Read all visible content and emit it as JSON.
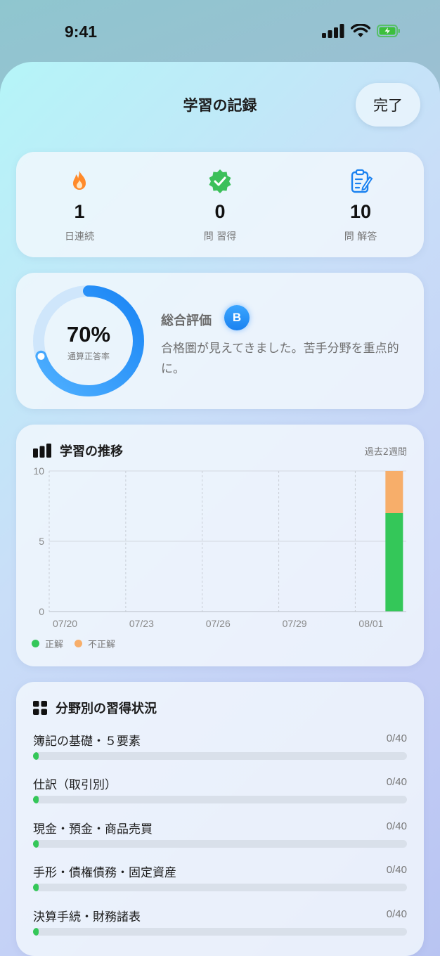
{
  "status_bar": {
    "time": "9:41"
  },
  "sheet": {
    "title": "学習の記録",
    "done_label": "完了"
  },
  "stats": [
    {
      "icon": "flame-icon",
      "value": "1",
      "label": "日連続"
    },
    {
      "icon": "verified-badge-icon",
      "value": "0",
      "label": "問 習得"
    },
    {
      "icon": "clipboard-edit-icon",
      "value": "10",
      "label": "問 解答"
    }
  ],
  "evaluation": {
    "percent_text": "70%",
    "percent_value": 0.7,
    "ring_label": "通算正答率",
    "title": "総合評価",
    "grade": "B",
    "message": "合格圏が見えてきました。苦手分野を重点的に。"
  },
  "trend": {
    "title": "学習の推移",
    "range": "過去2週間",
    "legend": {
      "correct": "正解",
      "incorrect": "不正解"
    }
  },
  "chart_data": {
    "type": "bar",
    "stacked": true,
    "x_tick_labels": [
      "07/20",
      "07/23",
      "07/26",
      "07/29",
      "08/01"
    ],
    "y_ticks": [
      "0",
      "5",
      "10"
    ],
    "ylim": [
      0,
      10
    ],
    "days": 14,
    "series": [
      {
        "name": "正解",
        "color": "#34c759",
        "values": [
          0,
          0,
          0,
          0,
          0,
          0,
          0,
          0,
          0,
          0,
          0,
          0,
          0,
          7
        ]
      },
      {
        "name": "不正解",
        "color": "#f7ae6a",
        "values": [
          0,
          0,
          0,
          0,
          0,
          0,
          0,
          0,
          0,
          0,
          0,
          0,
          0,
          3
        ]
      }
    ]
  },
  "fields": {
    "title": "分野別の習得状況",
    "items": [
      {
        "name": "簿記の基礎・５要素",
        "count": "0/40",
        "progress": 0.0
      },
      {
        "name": "仕訳（取引別）",
        "count": "0/40",
        "progress": 0.0
      },
      {
        "name": "現金・預金・商品売買",
        "count": "0/40",
        "progress": 0.0
      },
      {
        "name": "手形・債権債務・固定資産",
        "count": "0/40",
        "progress": 0.0
      },
      {
        "name": "決算手続・財務諸表",
        "count": "0/40",
        "progress": 0.0
      }
    ]
  },
  "colors": {
    "accent": "#1b82f0",
    "correct": "#34c759",
    "incorrect": "#f7ae6a"
  }
}
